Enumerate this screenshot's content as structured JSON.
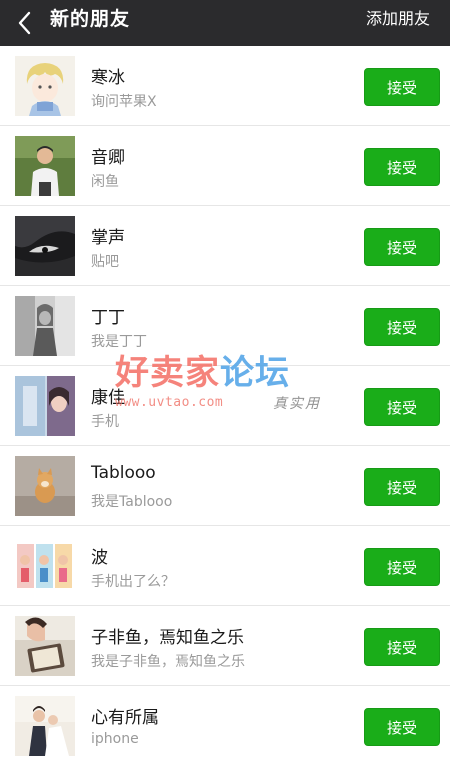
{
  "header": {
    "back_icon": "chevron-left-icon",
    "title": "新的朋友",
    "action_label": "添加朋友"
  },
  "colors": {
    "header_bg": "#2b2b2d",
    "accept_button_bg": "#1aad19",
    "watermark_pink": "#f5766d",
    "watermark_blue": "#57a7e8"
  },
  "friends": [
    {
      "name": "寒冰",
      "message": "询问苹果X",
      "button": "接受"
    },
    {
      "name": "音卿",
      "message": "闲鱼",
      "button": "接受"
    },
    {
      "name": "掌声",
      "message": "贴吧",
      "button": "接受"
    },
    {
      "name": "丁丁",
      "message": "我是丁丁",
      "button": "接受"
    },
    {
      "name": "康佳",
      "message": "手机",
      "button": "接受"
    },
    {
      "name": "Tablooo",
      "message": "我是Tablooo",
      "button": "接受"
    },
    {
      "name": "波",
      "message": "手机出了么？",
      "button": "接受"
    },
    {
      "name": "子非鱼，焉知鱼之乐",
      "message": "我是子非鱼，焉知鱼之乐",
      "button": "接受"
    },
    {
      "name": "心有所属",
      "message": "iphone",
      "button": "接受"
    }
  ],
  "watermark": {
    "part1": "好卖家",
    "part2": "论坛",
    "url": "www.uvtao.com",
    "slogan": "真实用"
  }
}
